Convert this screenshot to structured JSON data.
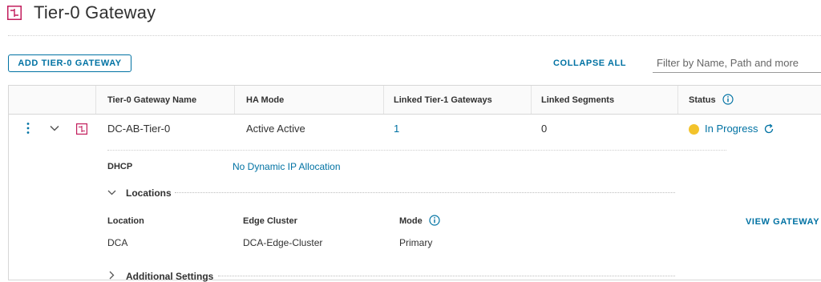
{
  "page": {
    "title": "Tier-0 Gateway"
  },
  "toolbar": {
    "add_label": "ADD TIER-0 GATEWAY",
    "collapse_all_label": "COLLAPSE ALL",
    "filter_placeholder": "Filter by Name, Path and more"
  },
  "grid": {
    "columns": [
      "Tier-0 Gateway Name",
      "HA Mode",
      "Linked Tier-1 Gateways",
      "Linked Segments",
      "Status"
    ],
    "rows": [
      {
        "name": "DC-AB-Tier-0",
        "ha_mode": "Active Active",
        "linked_tier1": "1",
        "linked_segments": "0",
        "status": "In Progress",
        "status_color": "#f3c32b"
      }
    ]
  },
  "details": {
    "dhcp_label": "DHCP",
    "dhcp_value": "No Dynamic IP Allocation",
    "locations_title": "Locations",
    "locations_columns": [
      "Location",
      "Edge Cluster",
      "Mode"
    ],
    "locations_rows": [
      {
        "location": "DCA",
        "edge_cluster": "DCA-Edge-Cluster",
        "mode": "Primary"
      }
    ],
    "view_gateway_label": "VIEW GATEWAY",
    "additional_settings_title": "Additional Settings"
  },
  "icons": {
    "gateway": "tier0-gateway-icon",
    "actions": "vertical-ellipsis-icon",
    "expand": "chevron-down-icon",
    "refresh": "refresh-icon",
    "info": "info-icon"
  },
  "colors": {
    "accent": "#0072a3",
    "gateway_icon": "#c21d5c",
    "in_progress": "#f3c32b"
  }
}
